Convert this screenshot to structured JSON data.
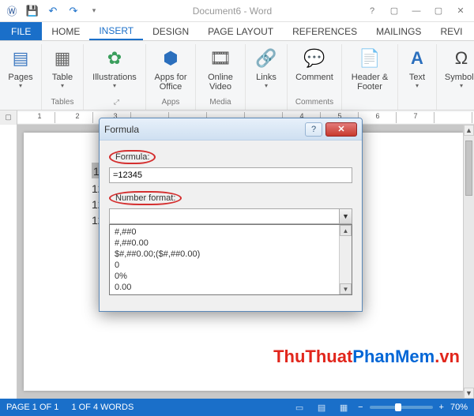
{
  "window": {
    "title": "Document6 - Word"
  },
  "qat": {
    "save": "💾",
    "undo": "↶",
    "redo": "↷",
    "customize": "▾"
  },
  "win": {
    "help": "?",
    "opts": "▢",
    "min": "—",
    "max": "▢",
    "close": "✕"
  },
  "tabs": {
    "file": "FILE",
    "home": "HOME",
    "insert": "INSERT",
    "design": "DESIGN",
    "layout": "PAGE LAYOUT",
    "references": "REFERENCES",
    "mailings": "MAILINGS",
    "review": "REVI"
  },
  "ribbon": {
    "pages": {
      "label": "Pages",
      "group": ""
    },
    "table": {
      "label": "Table",
      "group": "Tables"
    },
    "illus": {
      "label": "Illustrations",
      "group": ""
    },
    "apps": {
      "label": "Apps for Office",
      "group": "Apps"
    },
    "video": {
      "label": "Online Video",
      "group": "Media"
    },
    "links": {
      "label": "Links",
      "group": ""
    },
    "comment": {
      "label": "Comment",
      "group": "Comments"
    },
    "header": {
      "label": "Header & Footer",
      "group": ""
    },
    "text": {
      "label": "Text",
      "group": ""
    },
    "symbols": {
      "label": "Symbols",
      "group": ""
    }
  },
  "ruler": {
    "n1": "1",
    "n2": "2",
    "n3": "3",
    "n4": "4",
    "n5": "5",
    "n6": "6",
    "n7": "7"
  },
  "doc": {
    "l1": "1234",
    "l2": "1234",
    "l3": "1234",
    "l4": "1234"
  },
  "dialog": {
    "title": "Formula",
    "formula_label": "Formula:",
    "formula_value": "=12345",
    "numfmt_label": "Number format:",
    "numfmt_value": "",
    "options": [
      "#,##0",
      "#,##0.00",
      "$#,##0.00;($#,##0.00)",
      "0",
      "0%",
      "0.00"
    ]
  },
  "status": {
    "page": "PAGE 1 OF 1",
    "words": "1 OF 4 WORDS",
    "zoom": "70%"
  },
  "watermark": {
    "a": "ThuThuat",
    "b": "PhanMem",
    "c": ".vn"
  }
}
